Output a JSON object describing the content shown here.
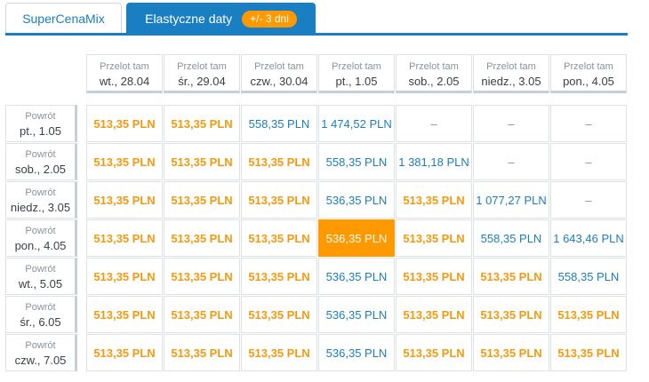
{
  "tabs": [
    {
      "label": "SuperCenaMix"
    },
    {
      "label": "Elastyczne daty",
      "badge": "+/- 3 dni"
    }
  ],
  "departures": [
    {
      "label": "Przelot tam",
      "date": "wt., 28.04"
    },
    {
      "label": "Przelot tam",
      "date": "śr., 29.04"
    },
    {
      "label": "Przelot tam",
      "date": "czw., 30.04"
    },
    {
      "label": "Przelot tam",
      "date": "pt., 1.05"
    },
    {
      "label": "Przelot tam",
      "date": "sob., 2.05"
    },
    {
      "label": "Przelot tam",
      "date": "niedz., 3.05"
    },
    {
      "label": "Przelot tam",
      "date": "pon., 4.05"
    }
  ],
  "returns": [
    {
      "label": "Powrót",
      "date": "pt., 1.05",
      "cells": [
        {
          "text": "513,35 PLN",
          "style": "cheap"
        },
        {
          "text": "513,35 PLN",
          "style": "cheap"
        },
        {
          "text": "558,35 PLN",
          "style": "regular"
        },
        {
          "text": "1 474,52 PLN",
          "style": "regular"
        },
        {
          "text": "–",
          "style": "na"
        },
        {
          "text": "–",
          "style": "na"
        },
        {
          "text": "–",
          "style": "na"
        }
      ]
    },
    {
      "label": "Powrót",
      "date": "sob., 2.05",
      "cells": [
        {
          "text": "513,35 PLN",
          "style": "cheap"
        },
        {
          "text": "513,35 PLN",
          "style": "cheap"
        },
        {
          "text": "513,35 PLN",
          "style": "cheap"
        },
        {
          "text": "558,35 PLN",
          "style": "regular"
        },
        {
          "text": "1 381,18 PLN",
          "style": "regular"
        },
        {
          "text": "–",
          "style": "na"
        },
        {
          "text": "–",
          "style": "na"
        }
      ]
    },
    {
      "label": "Powrót",
      "date": "niedz., 3.05",
      "cells": [
        {
          "text": "513,35 PLN",
          "style": "cheap"
        },
        {
          "text": "513,35 PLN",
          "style": "cheap"
        },
        {
          "text": "513,35 PLN",
          "style": "cheap"
        },
        {
          "text": "536,35 PLN",
          "style": "regular"
        },
        {
          "text": "513,35 PLN",
          "style": "cheap"
        },
        {
          "text": "1 077,27 PLN",
          "style": "regular"
        },
        {
          "text": "–",
          "style": "na"
        }
      ]
    },
    {
      "label": "Powrót",
      "date": "pon., 4.05",
      "cells": [
        {
          "text": "513,35 PLN",
          "style": "cheap"
        },
        {
          "text": "513,35 PLN",
          "style": "cheap"
        },
        {
          "text": "513,35 PLN",
          "style": "cheap"
        },
        {
          "text": "536,35 PLN",
          "style": "selected"
        },
        {
          "text": "513,35 PLN",
          "style": "cheap"
        },
        {
          "text": "558,35 PLN",
          "style": "regular"
        },
        {
          "text": "1 643,46 PLN",
          "style": "regular"
        }
      ]
    },
    {
      "label": "Powrót",
      "date": "wt., 5.05",
      "cells": [
        {
          "text": "513,35 PLN",
          "style": "cheap"
        },
        {
          "text": "513,35 PLN",
          "style": "cheap"
        },
        {
          "text": "513,35 PLN",
          "style": "cheap"
        },
        {
          "text": "536,35 PLN",
          "style": "regular"
        },
        {
          "text": "513,35 PLN",
          "style": "cheap"
        },
        {
          "text": "513,35 PLN",
          "style": "cheap"
        },
        {
          "text": "558,35 PLN",
          "style": "regular"
        }
      ]
    },
    {
      "label": "Powrót",
      "date": "śr., 6.05",
      "cells": [
        {
          "text": "513,35 PLN",
          "style": "cheap"
        },
        {
          "text": "513,35 PLN",
          "style": "cheap"
        },
        {
          "text": "513,35 PLN",
          "style": "cheap"
        },
        {
          "text": "536,35 PLN",
          "style": "regular"
        },
        {
          "text": "513,35 PLN",
          "style": "cheap"
        },
        {
          "text": "513,35 PLN",
          "style": "cheap"
        },
        {
          "text": "513,35 PLN",
          "style": "cheap"
        }
      ]
    },
    {
      "label": "Powrót",
      "date": "czw., 7.05",
      "cells": [
        {
          "text": "513,35 PLN",
          "style": "cheap"
        },
        {
          "text": "513,35 PLN",
          "style": "cheap"
        },
        {
          "text": "513,35 PLN",
          "style": "cheap"
        },
        {
          "text": "536,35 PLN",
          "style": "regular"
        },
        {
          "text": "513,35 PLN",
          "style": "cheap"
        },
        {
          "text": "513,35 PLN",
          "style": "cheap"
        },
        {
          "text": "513,35 PLN",
          "style": "cheap"
        }
      ]
    }
  ],
  "colors": {
    "accent_blue": "#1a7ec2",
    "cheap_orange": "#f59a10",
    "selected_orange": "#ff9900",
    "muted_gray": "#8a9299"
  }
}
